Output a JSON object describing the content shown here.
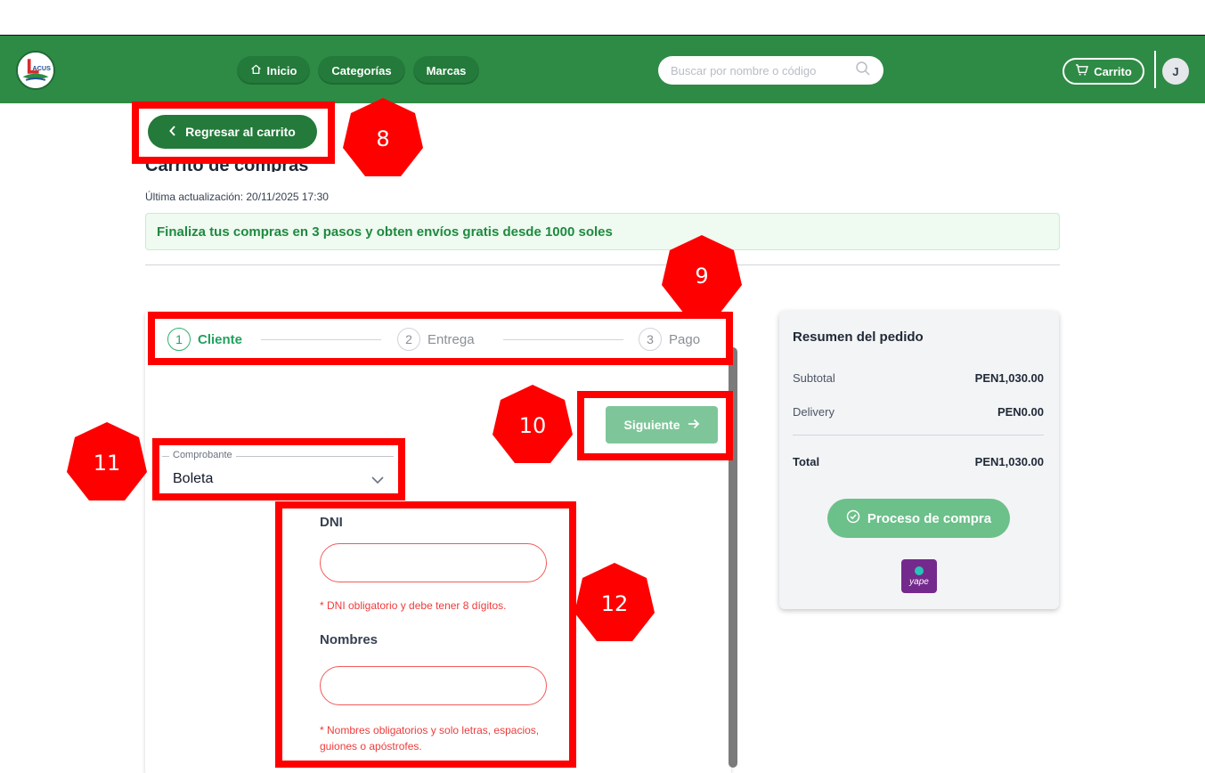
{
  "navbar": {
    "items": [
      {
        "label": "Inicio",
        "icon": "home-icon"
      },
      {
        "label": "Categorías"
      },
      {
        "label": "Marcas"
      }
    ],
    "search_placeholder": "Buscar por nombre o código",
    "cart_label": "Carrito",
    "avatar_initial": "J",
    "brand_color": "#2e8b45"
  },
  "page": {
    "back_label": "Regresar al carrito",
    "title": "Carrito de compras",
    "updated": "Última actualización: 20/11/2025 17:30",
    "banner": "Finaliza tus compras en 3 pasos y obten envíos gratis desde 1000 soles"
  },
  "stepper": {
    "steps": [
      {
        "num": "1",
        "label": "Cliente",
        "state": "active"
      },
      {
        "num": "2",
        "label": "Entrega",
        "state": "inactive"
      },
      {
        "num": "3",
        "label": "Pago",
        "state": "inactive"
      }
    ]
  },
  "form": {
    "next_label": "Siguiente",
    "comprobante_legend": "Comprobante",
    "comprobante_value": "Boleta",
    "dni_label": "DNI",
    "dni_error": "* DNI obligatorio y debe tener 8 dígitos.",
    "nombres_label": "Nombres",
    "nombres_error": "* Nombres obligatorios y solo letras, espacios, guiones o apóstrofes."
  },
  "summary": {
    "title": "Resumen del pedido",
    "rows": [
      {
        "key": "Subtotal",
        "value": "PEN1,030.00"
      },
      {
        "key": "Delivery",
        "value": "PEN0.00"
      }
    ],
    "total_key": "Total",
    "total_value": "PEN1,030.00",
    "process_label": "Proceso de compra",
    "payment_logo": "yape"
  },
  "annotations": [
    {
      "num": "8"
    },
    {
      "num": "9"
    },
    {
      "num": "10"
    },
    {
      "num": "11"
    },
    {
      "num": "12"
    }
  ]
}
